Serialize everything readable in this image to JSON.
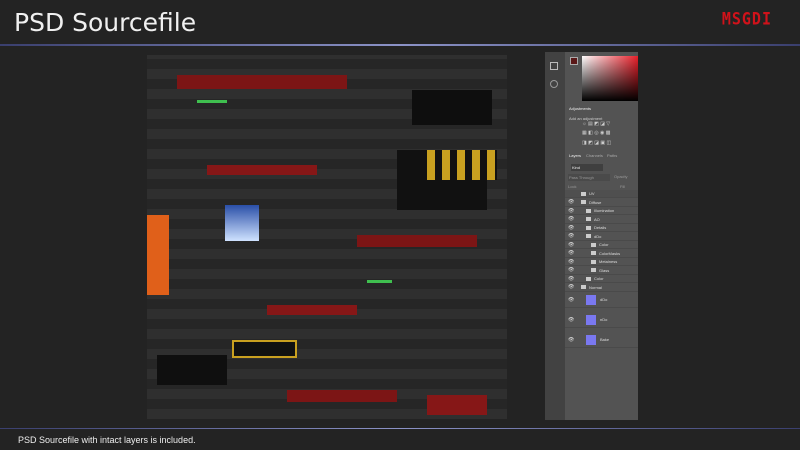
{
  "header": {
    "title": "PSD Sourcefile",
    "logo": "MSGDI"
  },
  "caption": "PSD Sourcefile with intact layers is included.",
  "colors": {
    "accent_rule": "#8c93c7",
    "logo": "#d0121a",
    "layer_thumb": "#7a78f0"
  },
  "photoshop": {
    "adjustments_tab": "Adjustments",
    "add_adjustment": "Add an adjustment",
    "tabs": [
      "Layers",
      "Channels",
      "Paths"
    ],
    "filter": "Kind",
    "blend_mode": "Pass Through",
    "opacity_label": "Opacity",
    "lock_label": "Lock",
    "fill_label": "Fill",
    "layers": [
      {
        "name": "UV",
        "type": "folder",
        "indent": 1
      },
      {
        "name": "Diffuse",
        "type": "folder",
        "indent": 1
      },
      {
        "name": "Illumination",
        "type": "folder",
        "indent": 2
      },
      {
        "name": "AO",
        "type": "folder",
        "indent": 2
      },
      {
        "name": "Details",
        "type": "folder",
        "indent": 2
      },
      {
        "name": "dDo",
        "type": "folder",
        "indent": 2
      },
      {
        "name": "Color",
        "type": "folder",
        "indent": 3
      },
      {
        "name": "ColorMasks",
        "type": "folder",
        "indent": 3
      },
      {
        "name": "Metalness",
        "type": "folder",
        "indent": 3
      },
      {
        "name": "Glass",
        "type": "folder",
        "indent": 3
      },
      {
        "name": "Color",
        "type": "folder",
        "indent": 2
      },
      {
        "name": "Normal",
        "type": "folder",
        "indent": 1
      },
      {
        "name": "dDo",
        "type": "layer",
        "indent": 2
      },
      {
        "name": "nDo",
        "type": "layer",
        "indent": 2
      },
      {
        "name": "Bake",
        "type": "layer",
        "indent": 2
      }
    ]
  }
}
